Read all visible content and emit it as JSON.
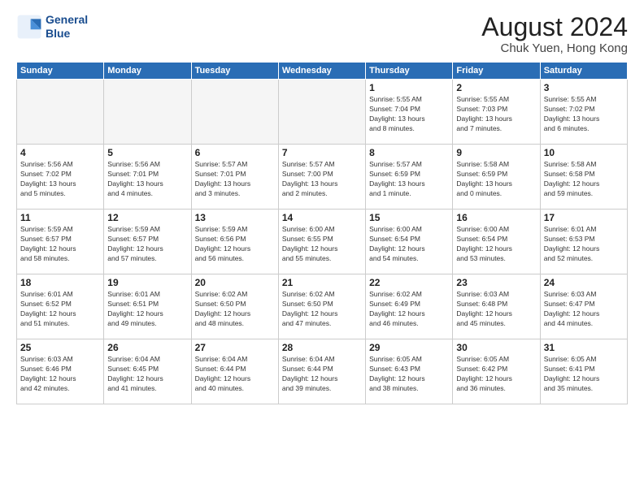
{
  "logo": {
    "line1": "General",
    "line2": "Blue"
  },
  "header": {
    "month": "August 2024",
    "location": "Chuk Yuen, Hong Kong"
  },
  "weekdays": [
    "Sunday",
    "Monday",
    "Tuesday",
    "Wednesday",
    "Thursday",
    "Friday",
    "Saturday"
  ],
  "weeks": [
    [
      {
        "day": "",
        "info": ""
      },
      {
        "day": "",
        "info": ""
      },
      {
        "day": "",
        "info": ""
      },
      {
        "day": "",
        "info": ""
      },
      {
        "day": "1",
        "info": "Sunrise: 5:55 AM\nSunset: 7:04 PM\nDaylight: 13 hours\nand 8 minutes."
      },
      {
        "day": "2",
        "info": "Sunrise: 5:55 AM\nSunset: 7:03 PM\nDaylight: 13 hours\nand 7 minutes."
      },
      {
        "day": "3",
        "info": "Sunrise: 5:55 AM\nSunset: 7:02 PM\nDaylight: 13 hours\nand 6 minutes."
      }
    ],
    [
      {
        "day": "4",
        "info": "Sunrise: 5:56 AM\nSunset: 7:02 PM\nDaylight: 13 hours\nand 5 minutes."
      },
      {
        "day": "5",
        "info": "Sunrise: 5:56 AM\nSunset: 7:01 PM\nDaylight: 13 hours\nand 4 minutes."
      },
      {
        "day": "6",
        "info": "Sunrise: 5:57 AM\nSunset: 7:01 PM\nDaylight: 13 hours\nand 3 minutes."
      },
      {
        "day": "7",
        "info": "Sunrise: 5:57 AM\nSunset: 7:00 PM\nDaylight: 13 hours\nand 2 minutes."
      },
      {
        "day": "8",
        "info": "Sunrise: 5:57 AM\nSunset: 6:59 PM\nDaylight: 13 hours\nand 1 minute."
      },
      {
        "day": "9",
        "info": "Sunrise: 5:58 AM\nSunset: 6:59 PM\nDaylight: 13 hours\nand 0 minutes."
      },
      {
        "day": "10",
        "info": "Sunrise: 5:58 AM\nSunset: 6:58 PM\nDaylight: 12 hours\nand 59 minutes."
      }
    ],
    [
      {
        "day": "11",
        "info": "Sunrise: 5:59 AM\nSunset: 6:57 PM\nDaylight: 12 hours\nand 58 minutes."
      },
      {
        "day": "12",
        "info": "Sunrise: 5:59 AM\nSunset: 6:57 PM\nDaylight: 12 hours\nand 57 minutes."
      },
      {
        "day": "13",
        "info": "Sunrise: 5:59 AM\nSunset: 6:56 PM\nDaylight: 12 hours\nand 56 minutes."
      },
      {
        "day": "14",
        "info": "Sunrise: 6:00 AM\nSunset: 6:55 PM\nDaylight: 12 hours\nand 55 minutes."
      },
      {
        "day": "15",
        "info": "Sunrise: 6:00 AM\nSunset: 6:54 PM\nDaylight: 12 hours\nand 54 minutes."
      },
      {
        "day": "16",
        "info": "Sunrise: 6:00 AM\nSunset: 6:54 PM\nDaylight: 12 hours\nand 53 minutes."
      },
      {
        "day": "17",
        "info": "Sunrise: 6:01 AM\nSunset: 6:53 PM\nDaylight: 12 hours\nand 52 minutes."
      }
    ],
    [
      {
        "day": "18",
        "info": "Sunrise: 6:01 AM\nSunset: 6:52 PM\nDaylight: 12 hours\nand 51 minutes."
      },
      {
        "day": "19",
        "info": "Sunrise: 6:01 AM\nSunset: 6:51 PM\nDaylight: 12 hours\nand 49 minutes."
      },
      {
        "day": "20",
        "info": "Sunrise: 6:02 AM\nSunset: 6:50 PM\nDaylight: 12 hours\nand 48 minutes."
      },
      {
        "day": "21",
        "info": "Sunrise: 6:02 AM\nSunset: 6:50 PM\nDaylight: 12 hours\nand 47 minutes."
      },
      {
        "day": "22",
        "info": "Sunrise: 6:02 AM\nSunset: 6:49 PM\nDaylight: 12 hours\nand 46 minutes."
      },
      {
        "day": "23",
        "info": "Sunrise: 6:03 AM\nSunset: 6:48 PM\nDaylight: 12 hours\nand 45 minutes."
      },
      {
        "day": "24",
        "info": "Sunrise: 6:03 AM\nSunset: 6:47 PM\nDaylight: 12 hours\nand 44 minutes."
      }
    ],
    [
      {
        "day": "25",
        "info": "Sunrise: 6:03 AM\nSunset: 6:46 PM\nDaylight: 12 hours\nand 42 minutes."
      },
      {
        "day": "26",
        "info": "Sunrise: 6:04 AM\nSunset: 6:45 PM\nDaylight: 12 hours\nand 41 minutes."
      },
      {
        "day": "27",
        "info": "Sunrise: 6:04 AM\nSunset: 6:44 PM\nDaylight: 12 hours\nand 40 minutes."
      },
      {
        "day": "28",
        "info": "Sunrise: 6:04 AM\nSunset: 6:44 PM\nDaylight: 12 hours\nand 39 minutes."
      },
      {
        "day": "29",
        "info": "Sunrise: 6:05 AM\nSunset: 6:43 PM\nDaylight: 12 hours\nand 38 minutes."
      },
      {
        "day": "30",
        "info": "Sunrise: 6:05 AM\nSunset: 6:42 PM\nDaylight: 12 hours\nand 36 minutes."
      },
      {
        "day": "31",
        "info": "Sunrise: 6:05 AM\nSunset: 6:41 PM\nDaylight: 12 hours\nand 35 minutes."
      }
    ]
  ]
}
